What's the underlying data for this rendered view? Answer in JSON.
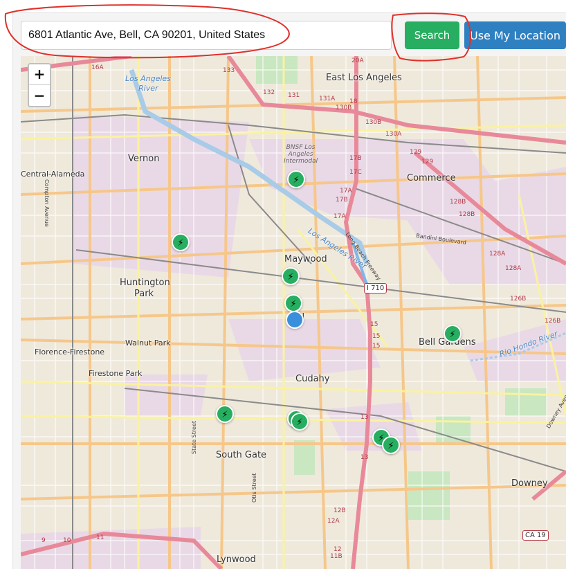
{
  "search": {
    "value": "6801 Atlantic Ave, Bell, CA 90201, United States",
    "search_label": "Search",
    "locate_label": "Use My Location"
  },
  "zoom": {
    "in_label": "+",
    "out_label": "−"
  },
  "map": {
    "places": [
      "East Los Angeles",
      "Vernon",
      "Central-Alameda",
      "Commerce",
      "Maywood",
      "Huntington",
      "Park",
      "Bell",
      "Walnut Park",
      "Florence-Firestone",
      "Firestone Park",
      "Cudahy",
      "Bell Gardens",
      "South Gate",
      "Downey",
      "Lynwood"
    ],
    "rivers": [
      "Los Angeles",
      "River",
      "Los Angeles River",
      "Rio Hondo River"
    ],
    "rail": [
      "BNSF Los",
      "Angeles",
      "Intermodal"
    ],
    "streets": [
      "Compton Avenue",
      "State Street",
      "Otis Street",
      "Bandini Boulevard",
      "Long Beach Freeway",
      "Downey Avenue"
    ],
    "exits": [
      "16A",
      "133",
      "132",
      "131",
      "131A",
      "18",
      "130B",
      "20A",
      "130B",
      "130A",
      "129",
      "17B",
      "17C",
      "17A",
      "17B",
      "17A",
      "129",
      "128B",
      "128B",
      "128A",
      "128A",
      "126B",
      "126B",
      "15",
      "15",
      "15",
      "13",
      "13",
      "12B",
      "12A",
      "11B",
      "12",
      "9",
      "10",
      "11"
    ],
    "shields": [
      "I 710",
      "CA 19"
    ],
    "marker_glyph": "⚡",
    "stations": 10,
    "colors": {
      "marker": "#27ae60",
      "user_dot": "#3a8fdc",
      "search_button": "#27ae60",
      "locate_button": "#2f80c1"
    }
  }
}
